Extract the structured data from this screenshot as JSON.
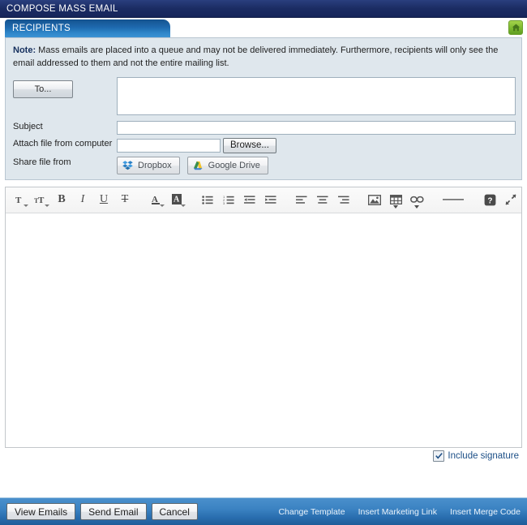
{
  "window": {
    "title": "COMPOSE MASS EMAIL",
    "home_icon": "home-icon"
  },
  "tab": {
    "label": "RECIPIENTS"
  },
  "panel": {
    "note_prefix": "Note:",
    "note_text": " Mass emails are placed into a queue and may not be delivered immediately. Furthermore, recipients will only see the email addressed to them and not the entire mailing list.",
    "to_button": "To...",
    "to_value": "",
    "subject_label": "Subject",
    "subject_value": "",
    "attach_label": "Attach file from computer",
    "attach_value": "",
    "browse_button": "Browse...",
    "share_label": "Share file from",
    "dropbox_button": "Dropbox",
    "google_drive_button": "Google Drive"
  },
  "toolbar": {
    "items": [
      {
        "name": "font-family-icon",
        "label": "T",
        "dropdown": true
      },
      {
        "name": "font-size-icon",
        "label": "TT",
        "dropdown": true
      },
      {
        "name": "bold-icon",
        "label": "B",
        "dropdown": false
      },
      {
        "name": "italic-icon",
        "label": "I",
        "dropdown": false
      },
      {
        "name": "underline-icon",
        "label": "U",
        "dropdown": false
      },
      {
        "name": "strikethrough-icon",
        "label": "T",
        "dropdown": false
      },
      {
        "name": "text-color-icon",
        "label": "A",
        "dropdown": true
      },
      {
        "name": "highlight-color-icon",
        "label": "A",
        "dropdown": true
      },
      {
        "name": "unordered-list-icon",
        "label": "",
        "dropdown": false
      },
      {
        "name": "ordered-list-icon",
        "label": "",
        "dropdown": false
      },
      {
        "name": "outdent-icon",
        "label": "",
        "dropdown": false
      },
      {
        "name": "indent-icon",
        "label": "",
        "dropdown": false
      },
      {
        "name": "align-left-icon",
        "label": "",
        "dropdown": false
      },
      {
        "name": "align-center-icon",
        "label": "",
        "dropdown": false
      },
      {
        "name": "align-right-icon",
        "label": "",
        "dropdown": false
      },
      {
        "name": "insert-image-icon",
        "label": "",
        "dropdown": false
      },
      {
        "name": "insert-table-icon",
        "label": "",
        "dropdown": true
      },
      {
        "name": "insert-link-icon",
        "label": "",
        "dropdown": true
      },
      {
        "name": "horizontal-rule-icon",
        "label": "",
        "dropdown": false
      },
      {
        "name": "help-icon",
        "label": "?",
        "dropdown": false
      },
      {
        "name": "fullscreen-icon",
        "label": "",
        "dropdown": false
      }
    ]
  },
  "editor": {
    "content": ""
  },
  "signature": {
    "label": "Include signature",
    "checked": true
  },
  "actions": {
    "view_emails": "View Emails",
    "send_email": "Send Email",
    "cancel": "Cancel",
    "change_template": "Change Template",
    "insert_marketing_link": "Insert Marketing Link",
    "insert_merge_code": "Insert Merge Code"
  },
  "colors": {
    "title_bar": "#1b2c63",
    "tab": "#1e6aaf",
    "panel_bg": "#dfe7ed",
    "action_bar": "#2a6fb0",
    "home_green": "#7cb82f",
    "link": "#eaf3fb"
  }
}
